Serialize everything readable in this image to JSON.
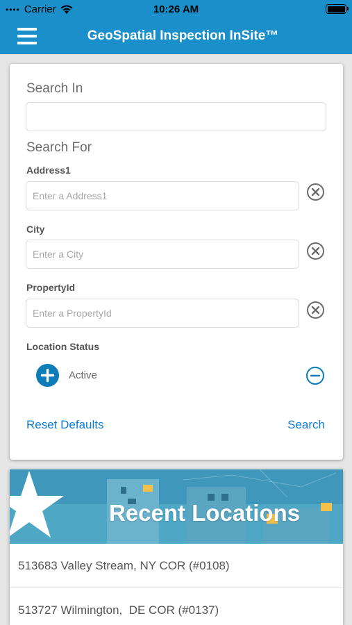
{
  "status_bar": {
    "carrier": "Carrier",
    "time": "10:26 AM"
  },
  "nav": {
    "title": "GeoSpatial Inspection InSite™",
    "menu_icon": "hamburger-menu-icon"
  },
  "search": {
    "search_in_title": "Search In",
    "search_in_value": "",
    "search_for_title": "Search For",
    "fields": [
      {
        "label": "Address1",
        "placeholder": "Enter a Address1",
        "value": ""
      },
      {
        "label": "City",
        "placeholder": "Enter a City",
        "value": ""
      },
      {
        "label": "PropertyId",
        "placeholder": "Enter a PropertyId",
        "value": ""
      }
    ],
    "clear_icon": "clear-circle-x-icon",
    "location_status_label": "Location Status",
    "location_status_value": "Active",
    "reset_label": "Reset Defaults",
    "search_label": "Search"
  },
  "recent": {
    "title": "Recent Locations",
    "items": [
      "513683 Valley Stream, NY COR (#0108)",
      "513727 Wilmington,  DE COR (#0137)"
    ]
  },
  "colors": {
    "brand": "#1a8fc9",
    "accent": "#0e7cb8",
    "link": "#0e7cd0"
  }
}
